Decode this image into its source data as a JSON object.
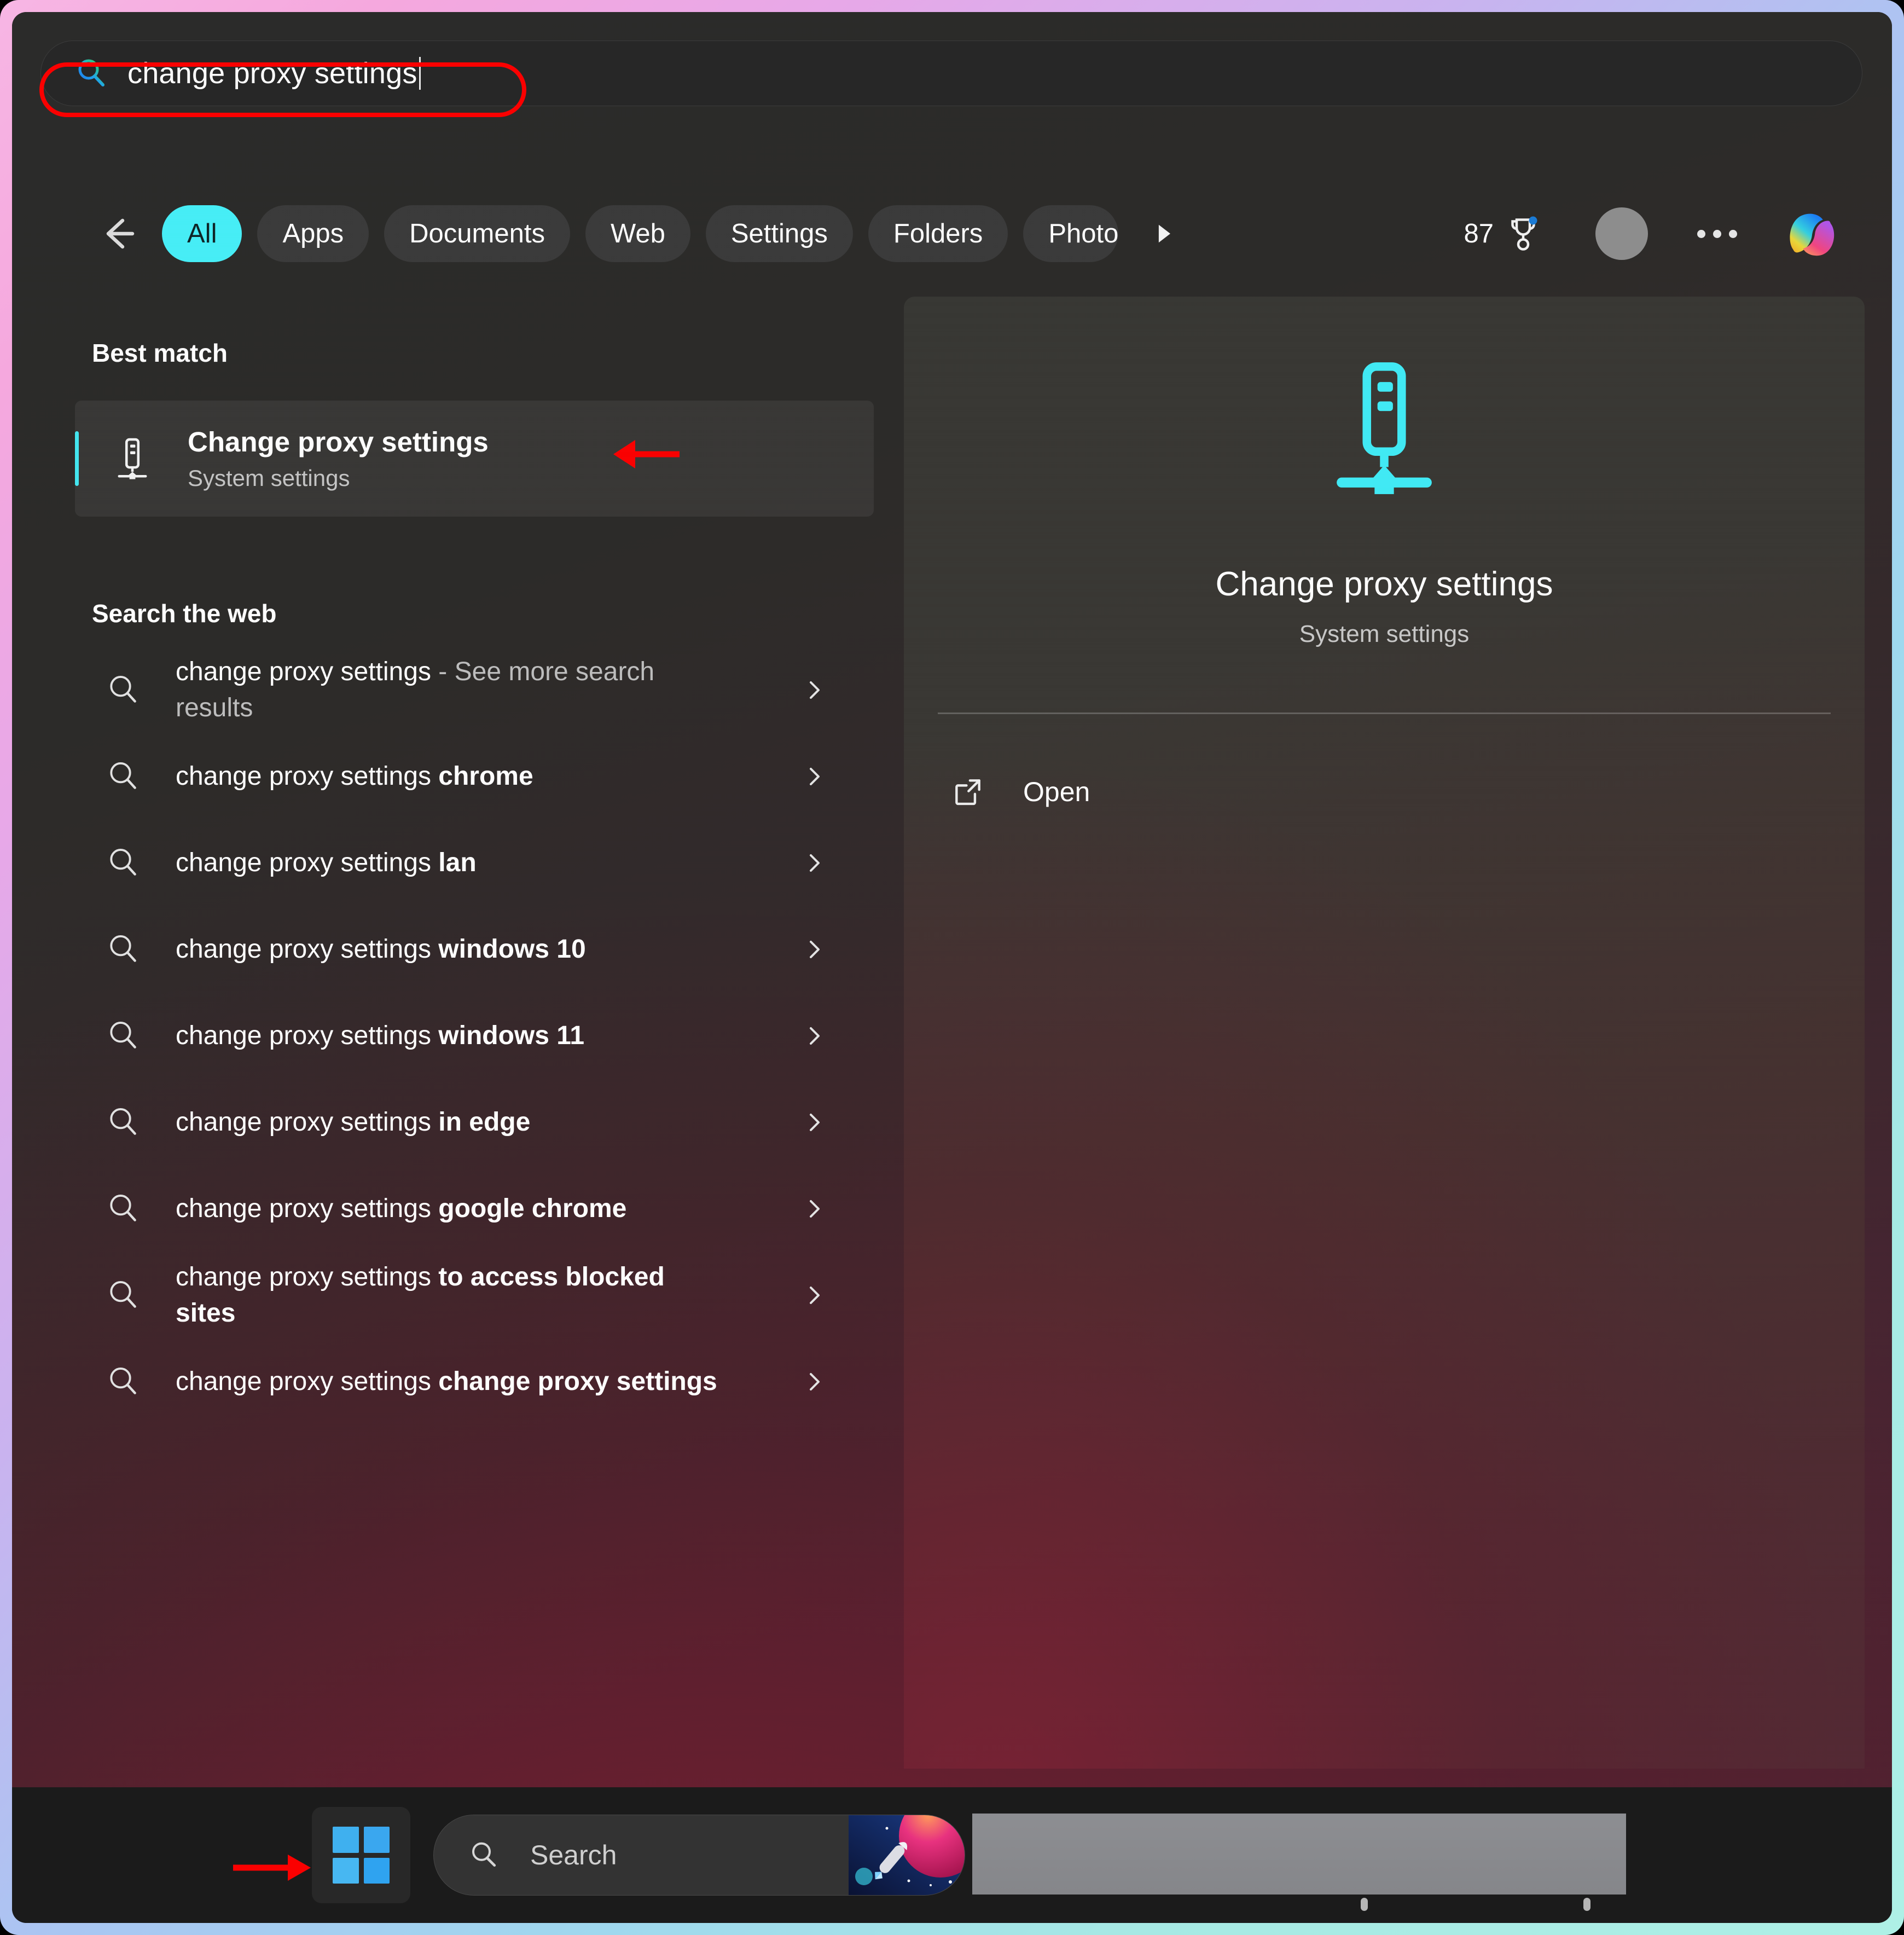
{
  "search": {
    "query": "change proxy settings",
    "icon": "search-icon",
    "annotation": "red-ellipse-annotation"
  },
  "tabs": {
    "back_icon": "back-arrow-icon",
    "items": [
      {
        "label": "All",
        "active": true
      },
      {
        "label": "Apps",
        "active": false
      },
      {
        "label": "Documents",
        "active": false
      },
      {
        "label": "Web",
        "active": false
      },
      {
        "label": "Settings",
        "active": false
      },
      {
        "label": "Folders",
        "active": false
      },
      {
        "label": "Photo",
        "active": false,
        "clipped": true
      }
    ],
    "more_icon": "scroll-right-icon",
    "rewards_count": "87",
    "rewards_icon": "rewards-trophy-icon",
    "avatar_icon": "account-avatar",
    "overflow_icon": "more-options-icon",
    "copilot_icon": "copilot-icon"
  },
  "results": {
    "best_match_heading": "Best match",
    "best_match": {
      "title": "Change proxy settings",
      "subtitle": "System settings",
      "icon": "proxy-server-icon",
      "annotation": "red-arrow-annotation"
    },
    "web_heading": "Search the web",
    "suggestions": [
      {
        "prefix": "change proxy settings",
        "bold": "",
        "dim": " - See more search results"
      },
      {
        "prefix": "change proxy settings ",
        "bold": "chrome",
        "dim": ""
      },
      {
        "prefix": "change proxy settings ",
        "bold": "lan",
        "dim": ""
      },
      {
        "prefix": "change proxy settings ",
        "bold": "windows 10",
        "dim": ""
      },
      {
        "prefix": "change proxy settings ",
        "bold": "windows 11",
        "dim": ""
      },
      {
        "prefix": "change proxy settings ",
        "bold": "in edge",
        "dim": ""
      },
      {
        "prefix": "change proxy settings ",
        "bold": "google chrome",
        "dim": ""
      },
      {
        "prefix": "change proxy settings ",
        "bold": "to access blocked sites",
        "dim": ""
      },
      {
        "prefix": "change proxy settings ",
        "bold": "change proxy settings",
        "dim": ""
      }
    ]
  },
  "preview": {
    "icon": "proxy-server-icon",
    "title": "Change proxy settings",
    "subtitle": "System settings",
    "actions": [
      {
        "label": "Open",
        "icon": "open-external-icon"
      }
    ]
  },
  "taskbar": {
    "start_icon": "windows-start-icon",
    "arrow_annotation": "red-arrow-annotation",
    "search_placeholder": "Search",
    "search_icon": "search-icon",
    "search_thumb_icon": "rocket-wallpaper-thumbnail",
    "redacted_block": "redacted-taskbar-region"
  },
  "colors": {
    "accent_cyan": "#46eef7",
    "annotation_red": "#fb0000",
    "frame_gradient_start": "#f7b6e4",
    "frame_gradient_end": "#aef0e6",
    "panel_dark": "#2a2a29"
  }
}
